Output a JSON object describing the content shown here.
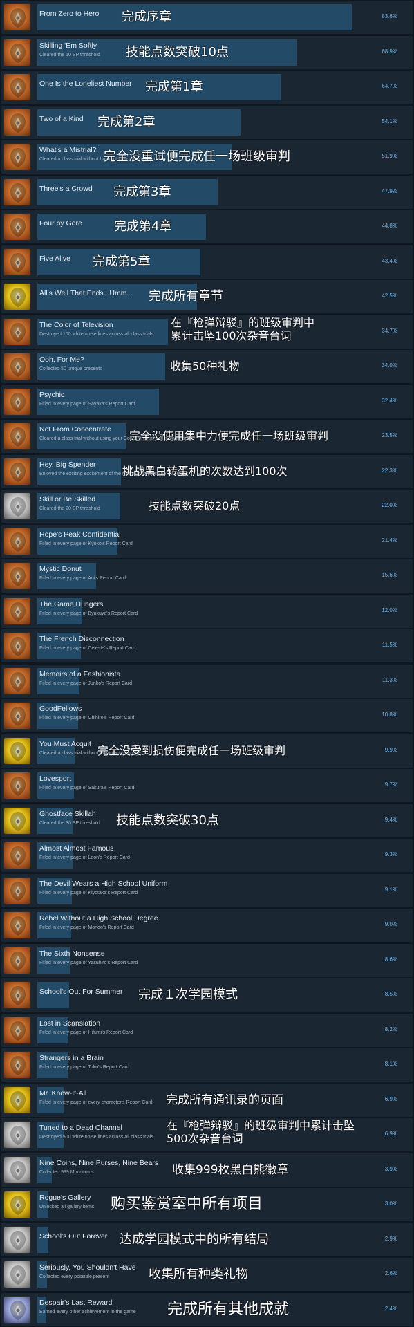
{
  "achievements": [
    {
      "name": "From Zero to Hero",
      "desc": "",
      "pct": "83.6%",
      "fill": 0.836,
      "icon": "bronze",
      "zh": "完成序章"
    },
    {
      "name": "Skilling 'Em Softly",
      "desc": "Cleared the 10 SP threshold",
      "pct": "68.9%",
      "fill": 0.689,
      "icon": "bronze",
      "zh": "技能点数突破10点"
    },
    {
      "name": "One Is the Loneliest Number",
      "desc": "",
      "pct": "64.7%",
      "fill": 0.647,
      "icon": "bronze",
      "zh": "完成第1章"
    },
    {
      "name": "Two of a Kind",
      "desc": "",
      "pct": "54.1%",
      "fill": 0.541,
      "icon": "bronze",
      "zh": "完成第2章"
    },
    {
      "name": "What's a Mistrial?",
      "desc": "Cleared a class trial without having to retry a single time",
      "pct": "51.9%",
      "fill": 0.519,
      "icon": "bronze",
      "zh": "完全没重试便完成任一场班级审判"
    },
    {
      "name": "Three's a Crowd",
      "desc": "",
      "pct": "47.9%",
      "fill": 0.479,
      "icon": "bronze",
      "zh": "完成第3章"
    },
    {
      "name": "Four by Gore",
      "desc": "",
      "pct": "44.8%",
      "fill": 0.448,
      "icon": "bronze",
      "zh": "完成第4章"
    },
    {
      "name": "Five Alive",
      "desc": "",
      "pct": "43.4%",
      "fill": 0.434,
      "icon": "bronze",
      "zh": "完成第5章"
    },
    {
      "name": "All's Well That Ends...Umm...",
      "desc": "",
      "pct": "42.5%",
      "fill": 0.425,
      "icon": "gold",
      "zh": "完成所有章节"
    },
    {
      "name": "The Color of Television",
      "desc": "Destroyed 100 white noise lines across all class trials",
      "pct": "34.7%",
      "fill": 0.347,
      "icon": "bronze",
      "zh": "在『枪弹辩驳』的班级审判中\n累计击坠100次杂音台词"
    },
    {
      "name": "Ooh, For Me?",
      "desc": "Collected 50 unique presents",
      "pct": "34.0%",
      "fill": 0.34,
      "icon": "bronze",
      "zh": "收集50种礼物"
    },
    {
      "name": "Psychic",
      "desc": "Filled in every page of Sayaka's Report Card",
      "pct": "32.4%",
      "fill": 0.324,
      "icon": "bronze",
      "zh": ""
    },
    {
      "name": "Not From Concentrate",
      "desc": "Cleared a class trial without using your Concentration skill a single time",
      "pct": "23.5%",
      "fill": 0.235,
      "icon": "bronze",
      "zh": "完全没使用集中力便完成任一场班级审判"
    },
    {
      "name": "Hey, Big Spender",
      "desc": "Enjoyed the exciting excitement of the MonoMono Machine 100 times",
      "pct": "22.3%",
      "fill": 0.223,
      "icon": "bronze",
      "zh": "挑战黑白转蛋机的次数达到100次"
    },
    {
      "name": "Skill or Be Skilled",
      "desc": "Cleared the 20 SP threshold",
      "pct": "22.0%",
      "fill": 0.22,
      "icon": "silver",
      "zh": "技能点数突破20点"
    },
    {
      "name": "Hope's Peak Confidential",
      "desc": "Filled in every page of Kyoko's Report Card",
      "pct": "21.4%",
      "fill": 0.214,
      "icon": "bronze",
      "zh": ""
    },
    {
      "name": "Mystic Donut",
      "desc": "Filled in every page of Aoi's Report Card",
      "pct": "15.6%",
      "fill": 0.156,
      "icon": "bronze",
      "zh": ""
    },
    {
      "name": "The Game Hungers",
      "desc": "Filled in every page of Byakuya's Report Card",
      "pct": "12.0%",
      "fill": 0.12,
      "icon": "bronze",
      "zh": ""
    },
    {
      "name": "The French Disconnection",
      "desc": "Filled in every page of Celeste's Report Card",
      "pct": "11.5%",
      "fill": 0.115,
      "icon": "bronze",
      "zh": ""
    },
    {
      "name": "Memoirs of a Fashionista",
      "desc": "Filled in every page of Junko's Report Card",
      "pct": "11.3%",
      "fill": 0.113,
      "icon": "bronze",
      "zh": ""
    },
    {
      "name": "GoodFellows",
      "desc": "Filled in every page of Chihiro's Report Card",
      "pct": "10.8%",
      "fill": 0.108,
      "icon": "bronze",
      "zh": ""
    },
    {
      "name": "You Must Acquit",
      "desc": "Cleared a class trial without taking any damage",
      "pct": "9.9%",
      "fill": 0.099,
      "icon": "gold",
      "zh": "完全没受到损伤便完成任一场班级审判"
    },
    {
      "name": "Lovesport",
      "desc": "Filled in every page of Sakura's Report Card",
      "pct": "9.7%",
      "fill": 0.097,
      "icon": "bronze",
      "zh": ""
    },
    {
      "name": "Ghostface Skillah",
      "desc": "Cleared the 30 SP threshold",
      "pct": "9.4%",
      "fill": 0.094,
      "icon": "gold",
      "zh": "技能点数突破30点"
    },
    {
      "name": "Almost Almost Famous",
      "desc": "Filled in every page of Leon's Report Card",
      "pct": "9.3%",
      "fill": 0.093,
      "icon": "bronze",
      "zh": ""
    },
    {
      "name": "The Devil Wears a High School Uniform",
      "desc": "Filled in every page of Kiyotaka's Report Card",
      "pct": "9.1%",
      "fill": 0.091,
      "icon": "bronze",
      "zh": ""
    },
    {
      "name": "Rebel Without a High School Degree",
      "desc": "Filled in every page of Mondo's Report Card",
      "pct": "9.0%",
      "fill": 0.09,
      "icon": "bronze",
      "zh": ""
    },
    {
      "name": "The Sixth Nonsense",
      "desc": "Filled in every page of Yasuhiro's Report Card",
      "pct": "8.6%",
      "fill": 0.086,
      "icon": "bronze",
      "zh": ""
    },
    {
      "name": "School's Out For Summer",
      "desc": "",
      "pct": "8.5%",
      "fill": 0.085,
      "icon": "bronze",
      "zh": "完成１次学园模式"
    },
    {
      "name": "Lost in Scanslation",
      "desc": "Filled in every page of Hifumi's Report Card",
      "pct": "8.2%",
      "fill": 0.082,
      "icon": "bronze",
      "zh": ""
    },
    {
      "name": "Strangers in a Brain",
      "desc": "Filled in every page of Toko's Report Card",
      "pct": "8.1%",
      "fill": 0.081,
      "icon": "bronze",
      "zh": ""
    },
    {
      "name": "Mr. Know-It-All",
      "desc": "Filled in every page of every character's Report Card",
      "pct": "6.9%",
      "fill": 0.069,
      "icon": "gold",
      "zh": "完成所有通讯录的页面"
    },
    {
      "name": "Tuned to a Dead Channel",
      "desc": "Destroyed 500 white noise lines across all class trials",
      "pct": "6.9%",
      "fill": 0.069,
      "icon": "silver",
      "zh": "在『枪弹辩驳』的班级审判中累计击坠\n500次杂音台词"
    },
    {
      "name": "Nine Coins, Nine Purses, Nine Bears",
      "desc": "Collected 999 Monocoins",
      "pct": "3.9%",
      "fill": 0.039,
      "icon": "silver",
      "zh": "收集999枚黑白熊徽章"
    },
    {
      "name": "Rogue's Gallery",
      "desc": "Unlocked all gallery items",
      "pct": "3.0%",
      "fill": 0.03,
      "icon": "gold",
      "zh": "购买鉴赏室中所有项目"
    },
    {
      "name": "School's Out Forever",
      "desc": "",
      "pct": "2.9%",
      "fill": 0.029,
      "icon": "silver",
      "zh": "达成学园模式中的所有结局"
    },
    {
      "name": "Seriously, You Shouldn't Have",
      "desc": "Collected every possible present",
      "pct": "2.6%",
      "fill": 0.026,
      "icon": "silver",
      "zh": "收集所有种类礼物"
    },
    {
      "name": "Despair's Last Reward",
      "desc": "Earned every other achievement in the game",
      "pct": "2.4%",
      "fill": 0.024,
      "icon": "platinum",
      "zh": "完成所有其他成就"
    }
  ]
}
